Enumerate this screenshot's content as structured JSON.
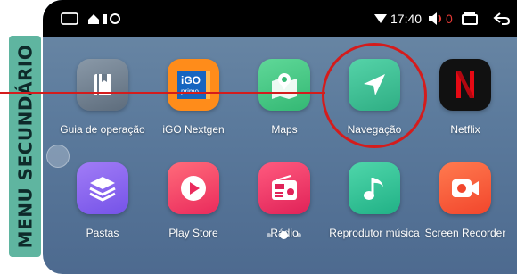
{
  "side_label": "MENU SECUNDÁRIO",
  "status_bar": {
    "time": "17:40",
    "volume": "0",
    "left_icons": [
      "home-outline-icon",
      "notification-icons"
    ],
    "right_icons": [
      "wifi-icon",
      "volume-muted-icon",
      "recents-icon",
      "back-icon"
    ]
  },
  "apps": [
    {
      "label": "Guia de operação",
      "icon": "guide-book-icon",
      "color": "#6f7f8f"
    },
    {
      "label": "iGO Nextgen",
      "icon": "igo-primo-icon",
      "color": "#ff8c1a",
      "logo_text": "iGO primo"
    },
    {
      "label": "Maps",
      "icon": "maps-icon",
      "color": "#4cc98a"
    },
    {
      "label": "Navegação",
      "icon": "navigation-arrow-icon",
      "color": "#3fbf95"
    },
    {
      "label": "Netflix",
      "icon": "netflix-icon",
      "color": "#111111",
      "logo_text": "N"
    },
    {
      "label": "Pastas",
      "icon": "folders-icon",
      "color": "#8b6bf0"
    },
    {
      "label": "Play Store",
      "icon": "play-store-icon",
      "color": "#f24a6a"
    },
    {
      "label": "Rádio",
      "icon": "radio-icon",
      "color": "#ee3d6a"
    },
    {
      "label": "Reprodutor música",
      "icon": "music-note-icon",
      "color": "#34c79a"
    },
    {
      "label": "Screen Recorder",
      "icon": "screen-recorder-icon",
      "color": "#f5603a"
    }
  ],
  "pager": {
    "pages": 3,
    "active": 2
  },
  "highlight": {
    "target": "Navegação",
    "color": "#d41c1c"
  }
}
